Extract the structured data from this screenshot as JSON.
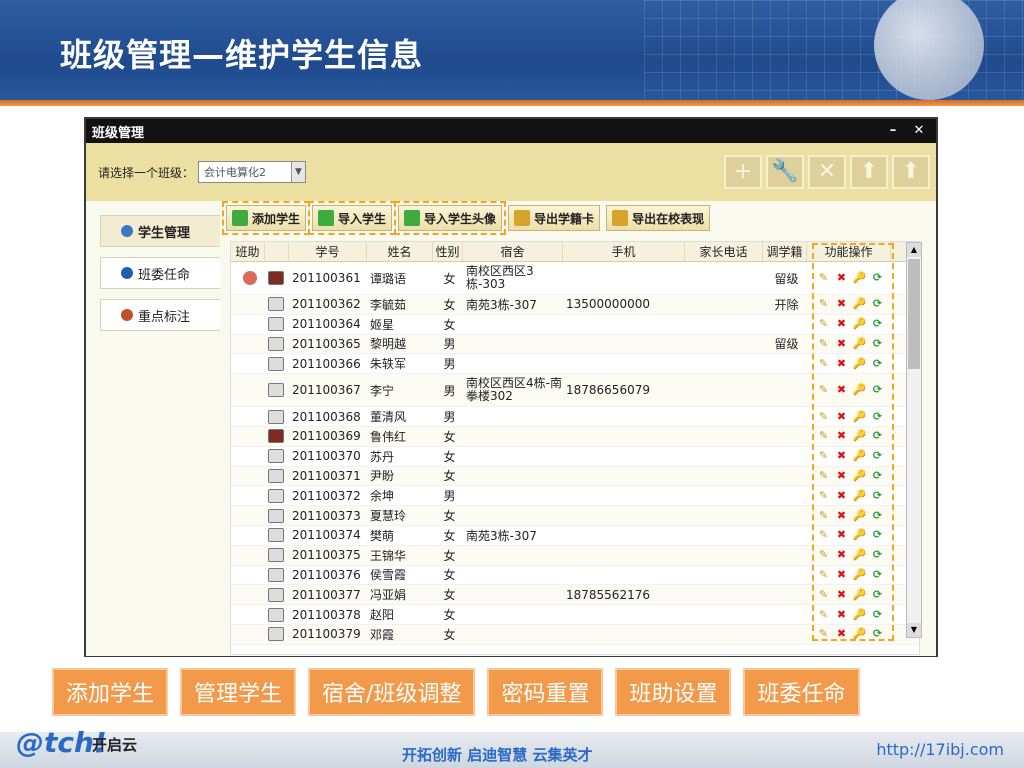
{
  "slide": {
    "title": "班级管理—维护学生信息",
    "slogan": "开拓创新 启迪智慧 云集英才",
    "url": "http://17ibj.com",
    "logo_text": "@tch!",
    "logo_cn": "开启云"
  },
  "window": {
    "title": "班级管理",
    "minimize": "–",
    "close": "✕"
  },
  "class_picker": {
    "label": "请选择一个班级：",
    "selected": "会计电算化2"
  },
  "top_tools": [
    "+",
    "🔧",
    "✕",
    "⬆",
    "⬆"
  ],
  "side_menu": [
    {
      "label": "学生管理",
      "color": "#3a78c4"
    },
    {
      "label": "班委任命",
      "color": "#1e5fb3"
    },
    {
      "label": "重点标注",
      "color": "#c0522b"
    }
  ],
  "toolbar": [
    {
      "label": "添加学生",
      "color": "#3eab3e",
      "highlight": true
    },
    {
      "label": "导入学生",
      "color": "#3eab3e",
      "highlight": true
    },
    {
      "label": "导入学生头像",
      "color": "#3eab3e",
      "highlight": true
    },
    {
      "label": "导出学籍卡",
      "color": "#d7a32a",
      "highlight": false
    },
    {
      "label": "导出在校表现",
      "color": "#d7a32a",
      "highlight": false
    }
  ],
  "grid": {
    "columns": [
      "班助",
      "学号",
      "姓名",
      "性别",
      "宿舍",
      "手机",
      "家长电话",
      "调学籍",
      "功能操作"
    ],
    "rows": [
      {
        "tutor": true,
        "photo": true,
        "id": "201100361",
        "name": "谭璐语",
        "sex": "女",
        "dorm": "南校区西区3栋-303",
        "phone": "",
        "pphone": "",
        "status": "留级"
      },
      {
        "tutor": false,
        "photo": false,
        "id": "201100362",
        "name": "李毓茹",
        "sex": "女",
        "dorm": "南苑3栋-307",
        "phone": "13500000000",
        "pphone": "",
        "status": "开除"
      },
      {
        "tutor": false,
        "photo": false,
        "id": "201100364",
        "name": "姬星",
        "sex": "女",
        "dorm": "",
        "phone": "",
        "pphone": "",
        "status": ""
      },
      {
        "tutor": false,
        "photo": false,
        "id": "201100365",
        "name": "黎明越",
        "sex": "男",
        "dorm": "",
        "phone": "",
        "pphone": "",
        "status": "留级"
      },
      {
        "tutor": false,
        "photo": false,
        "id": "201100366",
        "name": "朱轶军",
        "sex": "男",
        "dorm": "",
        "phone": "",
        "pphone": "",
        "status": ""
      },
      {
        "tutor": false,
        "photo": false,
        "id": "201100367",
        "name": "李宁",
        "sex": "男",
        "dorm": "南校区西区4栋-南拳楼302",
        "phone": "18786656079",
        "pphone": "",
        "status": ""
      },
      {
        "tutor": false,
        "photo": false,
        "id": "201100368",
        "name": "董清风",
        "sex": "男",
        "dorm": "",
        "phone": "",
        "pphone": "",
        "status": ""
      },
      {
        "tutor": false,
        "photo": true,
        "id": "201100369",
        "name": "鲁伟红",
        "sex": "女",
        "dorm": "",
        "phone": "",
        "pphone": "",
        "status": ""
      },
      {
        "tutor": false,
        "photo": false,
        "id": "201100370",
        "name": "苏丹",
        "sex": "女",
        "dorm": "",
        "phone": "",
        "pphone": "",
        "status": ""
      },
      {
        "tutor": false,
        "photo": false,
        "id": "201100371",
        "name": "尹盼",
        "sex": "女",
        "dorm": "",
        "phone": "",
        "pphone": "",
        "status": ""
      },
      {
        "tutor": false,
        "photo": false,
        "id": "201100372",
        "name": "余坤",
        "sex": "男",
        "dorm": "",
        "phone": "",
        "pphone": "",
        "status": ""
      },
      {
        "tutor": false,
        "photo": false,
        "id": "201100373",
        "name": "夏慧玲",
        "sex": "女",
        "dorm": "",
        "phone": "",
        "pphone": "",
        "status": ""
      },
      {
        "tutor": false,
        "photo": false,
        "id": "201100374",
        "name": "樊萌",
        "sex": "女",
        "dorm": "南苑3栋-307",
        "phone": "",
        "pphone": "",
        "status": ""
      },
      {
        "tutor": false,
        "photo": false,
        "id": "201100375",
        "name": "王锦华",
        "sex": "女",
        "dorm": "",
        "phone": "",
        "pphone": "",
        "status": ""
      },
      {
        "tutor": false,
        "photo": false,
        "id": "201100376",
        "name": "侯雪霞",
        "sex": "女",
        "dorm": "",
        "phone": "",
        "pphone": "",
        "status": ""
      },
      {
        "tutor": false,
        "photo": false,
        "id": "201100377",
        "name": "冯亚娟",
        "sex": "女",
        "dorm": "",
        "phone": "18785562176",
        "pphone": "",
        "status": ""
      },
      {
        "tutor": false,
        "photo": false,
        "id": "201100378",
        "name": "赵阳",
        "sex": "女",
        "dorm": "",
        "phone": "",
        "pphone": "",
        "status": ""
      },
      {
        "tutor": false,
        "photo": false,
        "id": "201100379",
        "name": "邓霞",
        "sex": "女",
        "dorm": "",
        "phone": "",
        "pphone": "",
        "status": ""
      }
    ]
  },
  "actions": [
    "✎",
    "✖",
    "🔑",
    "⟳"
  ],
  "feature_buttons": [
    "添加学生",
    "管理学生",
    "宿舍/班级调整",
    "密码重置",
    "班助设置",
    "班委任命"
  ]
}
